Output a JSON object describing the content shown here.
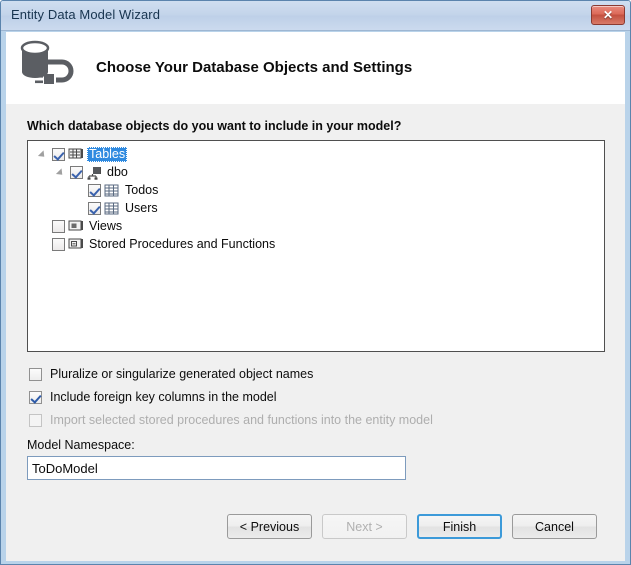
{
  "window": {
    "title": "Entity Data Model Wizard",
    "close_label": "✕",
    "accent_blue": "#3c9ad9",
    "selection_blue": "#2f8ae0",
    "titlebar_color": "#c3d4ea",
    "body_color": "#f0f0f0"
  },
  "header": {
    "icon": "database-plug-icon",
    "title": "Choose Your Database Objects and Settings"
  },
  "main": {
    "question": "Which database objects do you want to include in your model?",
    "tree": [
      {
        "label": "Tables",
        "icon": "tables-folder-icon",
        "checked": true,
        "selected": true,
        "expanded": true,
        "indent": 0
      },
      {
        "label": "dbo",
        "icon": "schema-icon",
        "checked": true,
        "selected": false,
        "expanded": true,
        "indent": 1
      },
      {
        "label": "Todos",
        "icon": "table-grid-icon",
        "checked": true,
        "selected": false,
        "expanded": null,
        "indent": 2
      },
      {
        "label": "Users",
        "icon": "table-grid-icon",
        "checked": true,
        "selected": false,
        "expanded": null,
        "indent": 2
      },
      {
        "label": "Views",
        "icon": "views-folder-icon",
        "checked": false,
        "selected": false,
        "expanded": null,
        "indent": 0
      },
      {
        "label": "Stored Procedures and Functions",
        "icon": "stored-procedures-folder-icon",
        "checked": false,
        "selected": false,
        "expanded": null,
        "indent": 0
      }
    ],
    "options": [
      {
        "label": "Pluralize or singularize generated object names",
        "checked": false,
        "disabled": false
      },
      {
        "label": "Include foreign key columns in the model",
        "checked": true,
        "disabled": false
      },
      {
        "label": "Import selected stored procedures and functions into the entity model",
        "checked": false,
        "disabled": true
      }
    ],
    "namespace": {
      "label": "Model Namespace:",
      "value": "ToDoModel",
      "placeholder": ""
    }
  },
  "footer": {
    "previous": "< Previous",
    "next": "Next >",
    "finish": "Finish",
    "cancel": "Cancel"
  }
}
